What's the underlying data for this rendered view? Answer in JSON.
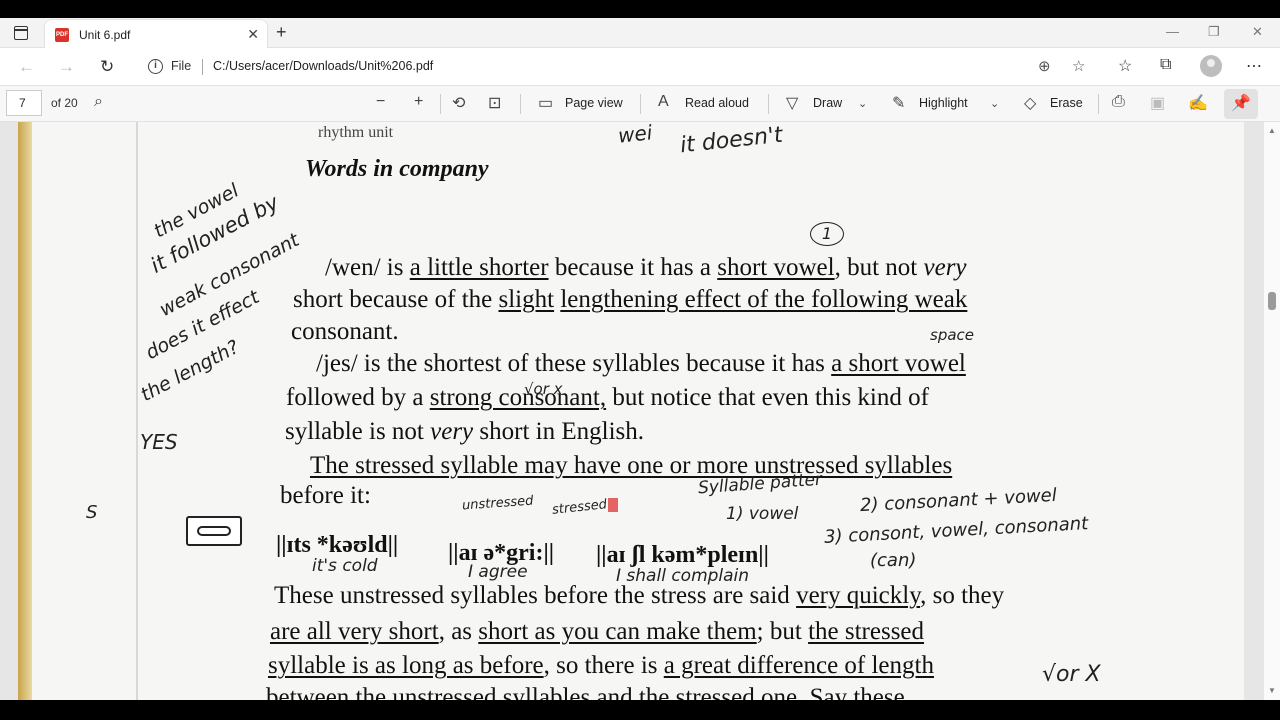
{
  "window": {
    "tab_title": "Unit 6.pdf",
    "pdf_badge": "PDF",
    "new_tab": "+",
    "tab_close": "✕",
    "minimize": "—",
    "restore": "❐",
    "close": "✕"
  },
  "address": {
    "file_label": "File",
    "url": "C:/Users/acer/Downloads/Unit%206.pdf"
  },
  "pdf_toolbar": {
    "page_number": "7",
    "page_count": "of 20",
    "page_view": "Page view",
    "read_aloud": "Read aloud",
    "draw": "Draw",
    "highlight": "Highlight",
    "erase": "Erase"
  },
  "document": {
    "top_fragment": "rhythm unit",
    "heading": "Words in company",
    "p1": [
      "/wen/ is ",
      "a little shorter",
      " because it has a ",
      "short vowel",
      ", but not ",
      "very"
    ],
    "p1b": [
      "short because of the ",
      "slight",
      " ",
      "lengthening effect of the following weak"
    ],
    "p1c": "consonant.",
    "p2": [
      "/jes/ is the shortest of these syllables because it has ",
      "a short vowel"
    ],
    "p2b": [
      "followed by a ",
      "strong consonant,",
      " but notice that even this kind of"
    ],
    "p2c": [
      "syllable is not ",
      "very",
      " short in English."
    ],
    "p3": [
      "The stressed syllable may have one or more unstressed syllables"
    ],
    "p3b": "before it:",
    "phon1": "||ɪts *kəʊld||",
    "phon2": "||aɪ ə*gri:||",
    "phon3": "||aɪ ʃl kəm*pleɪn||",
    "p4": [
      "These unstressed syllables before the stress are said ",
      "very quickly",
      ", so they"
    ],
    "p4b": [
      "are all very short",
      ", as ",
      "short as you can make them",
      "; but ",
      "the stressed"
    ],
    "p4c": [
      "syllable is as long as before",
      ", so there is ",
      "a great difference of length"
    ],
    "p4d": "between the unstressed syllables and the stressed one. Say these"
  },
  "handwriting": {
    "top_right": "it doesn't",
    "top_right2": "wei",
    "margin1": "the vowel",
    "margin2": "it followed by",
    "margin3": "weak consonant",
    "margin4": "does it effect",
    "margin5": "the length?",
    "margin6": "YES",
    "margin_s": "S",
    "circle_one": "1",
    "space": "space",
    "vorx": "√or x",
    "unstressed": "unstressed",
    "stressed": "stressed",
    "pattern": "Syllable patter",
    "pattern1": "1) vowel",
    "pattern2": "2) consonant + vowel",
    "pattern3": "3) consont, vowel, consonant",
    "can": "(can)",
    "its_cold": "it's cold",
    "i_agree": "I agree",
    "i_shall": "I shall complain",
    "vorx2": "√or X"
  }
}
